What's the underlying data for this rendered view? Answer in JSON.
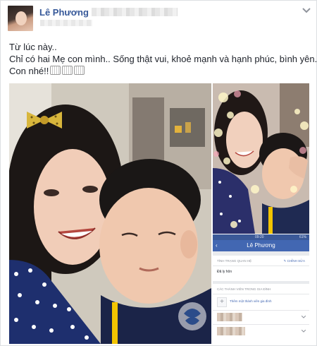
{
  "post": {
    "author_name": "Lê Phương",
    "lines": [
      "Từ lúc này..",
      "Chỉ có hai Mẹ con mình.. Sống thật vui, khoẻ mạnh và hạnh phúc, bình yên..",
      "Con nhé!!"
    ],
    "emoji_count": 3,
    "colors": {
      "link": "#365899",
      "text": "#1d2129",
      "fb_blue": "#4267b2"
    }
  },
  "icons": {
    "menu": "chevron-down-icon",
    "hair_clip": "bow-icon",
    "watermark": "swirl-logo-icon"
  },
  "phone": {
    "status_time": "09:20",
    "status_battery": "61%",
    "title": "Lê Phương",
    "relationship_header": "TÌNH TRẠNG QUAN HỆ",
    "edit_link": "✎ CHỈNH SỬA",
    "relationship_value": "Đã ly hôn",
    "family_header": "CÁC THÀNH VIÊN TRONG GIA ĐÌNH",
    "add_family": "Thêm một thành viên gia đình"
  }
}
